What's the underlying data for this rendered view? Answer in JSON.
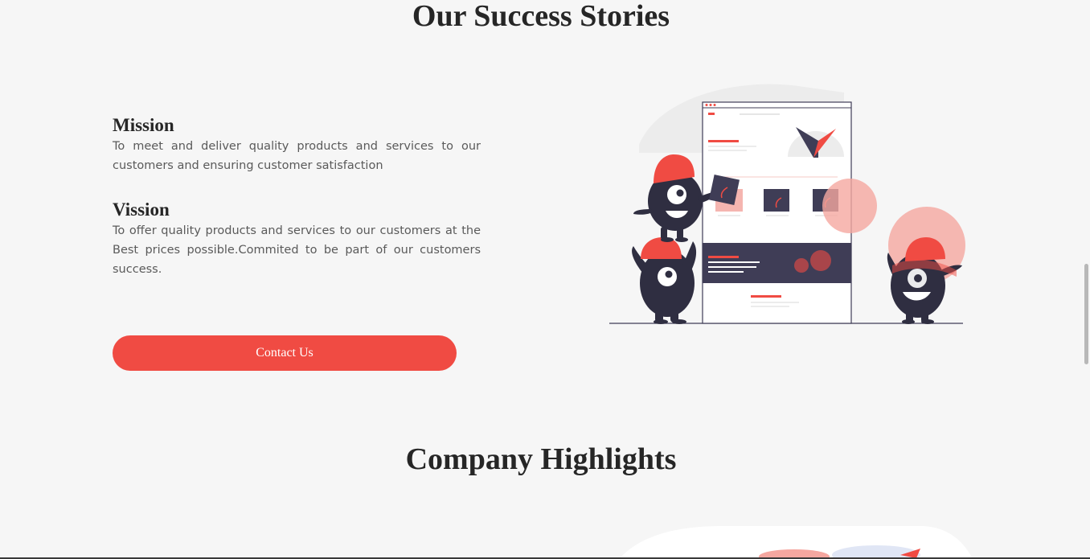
{
  "success": {
    "title": "Our Success Stories",
    "mission": {
      "heading": "Mission",
      "text": "To meet and deliver quality products and services to our customers and ensuring customer satisfaction"
    },
    "vission": {
      "heading": "Vission",
      "text": "To offer quality products and services to our customers at the Best prices possible.Commited to be part of our customers success."
    },
    "contact_label": "Contact Us"
  },
  "highlights": {
    "title": "Company Highlights"
  },
  "colors": {
    "accent": "#f04b43",
    "dark": "#2f2e41",
    "background": "#f6f6f6",
    "pink": "#f5b5b0"
  }
}
